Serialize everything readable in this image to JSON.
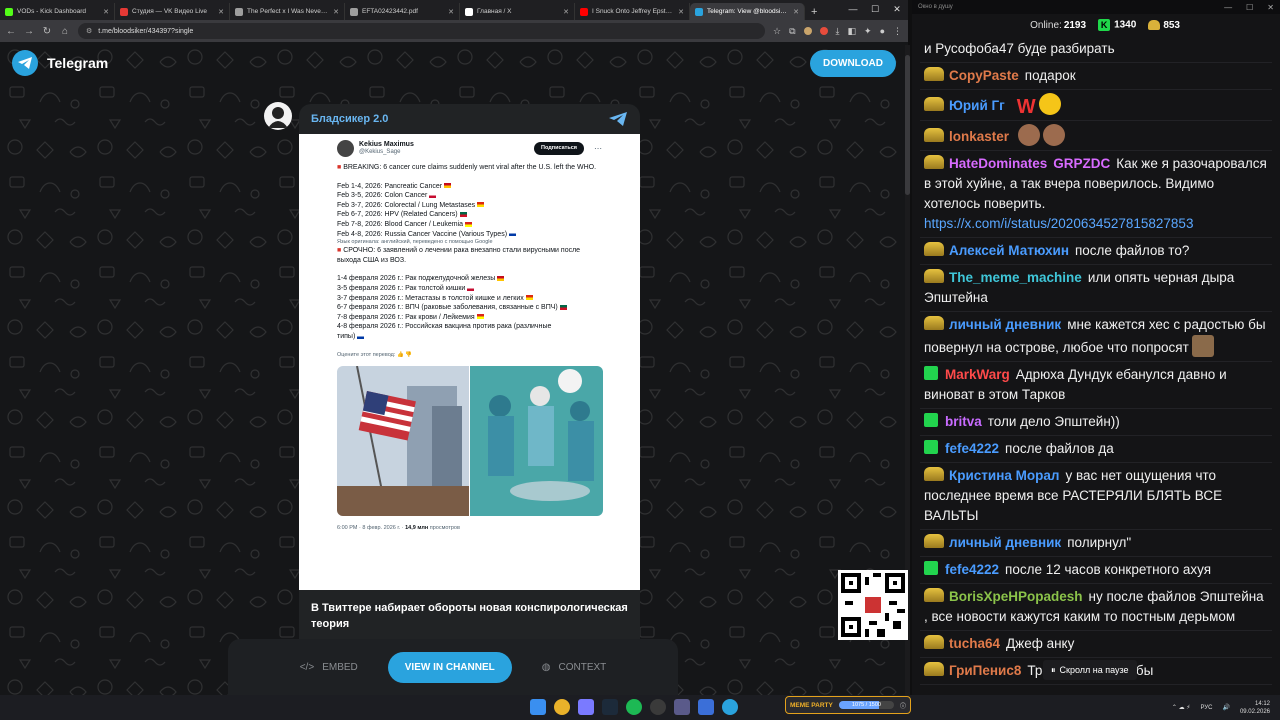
{
  "browser": {
    "tabs": [
      {
        "label": "VODs - Kick Dashboard",
        "color": "#53fc18",
        "active": false
      },
      {
        "label": "Студия — VK Видео Live",
        "color": "#e53935",
        "active": false
      },
      {
        "label": "The Perfect x I Was Never Th",
        "color": "#9e9e9e",
        "active": false
      },
      {
        "label": "EFTA02423442.pdf",
        "color": "#9e9e9e",
        "active": false
      },
      {
        "label": "Главная / X",
        "color": "#ffffff",
        "active": false
      },
      {
        "label": "I Snuck Onto Jeffrey Epstein'",
        "color": "#ff0000",
        "active": false
      },
      {
        "label": "Telegram: View @bloodsiker",
        "color": "#2aa3de",
        "active": true
      }
    ],
    "url": "t.me/bloodsiker/434397?single"
  },
  "telegram": {
    "app_name": "Telegram",
    "download_label": "DOWNLOAD",
    "channel_name": "Бладсикер 2.0",
    "caption": "В Твиттере набирает обороты новая конспирологическая теория",
    "buttons": {
      "embed": "EMBED",
      "view_in_channel": "VIEW IN CHANNEL",
      "context": "CONTEXT"
    },
    "tweet": {
      "name": "Kekius Maximus",
      "handle": "@Kekius_Sage",
      "follow": "Подписаться",
      "breaking": "BREAKING: 6 cancer cure claims suddenly went viral after the U.S. left the WHO.",
      "en_items": [
        {
          "text": "Feb 1-4, 2026: Pancreatic Cancer",
          "flag": "es"
        },
        {
          "text": "Feb 3-5, 2026: Colon Cancer",
          "flag": "kr"
        },
        {
          "text": "Feb 3-7, 2026: Colorectal / Lung Metastases",
          "flag": "cn"
        },
        {
          "text": "Feb 6-7, 2026: HPV (Related Cancers)",
          "flag": "mx"
        },
        {
          "text": "Feb 7-8, 2026: Blood Cancer / Leukemia",
          "flag": "vn"
        },
        {
          "text": "Feb 4-8, 2026: Russia Cancer Vaccine (Various Types)",
          "flag": "ru"
        }
      ],
      "translated_note": "Язык оригинала: английский, переведено с помощью Google",
      "ru_breaking": "СРОЧНО: 6 заявлений о лечении рака внезапно стали вирусными после выхода США из ВОЗ.",
      "ru_items": [
        {
          "text": "1-4 февраля 2026 г.: Рак поджелудочной железы",
          "flag": "es"
        },
        {
          "text": "3-5 февраля 2026 г.: Рак толстой кишки",
          "flag": "kr"
        },
        {
          "text": "3-7 февраля 2026 г.: Метастазы в толстой кишке и легких",
          "flag": "cn"
        },
        {
          "text": "6-7 февраля 2026 г.: ВПЧ (раковые заболевания, связанные с ВПЧ)",
          "flag": "mx"
        },
        {
          "text": "7-8 февраля 2026 г.: Рак крови / Лейкемия",
          "flag": "vn"
        },
        {
          "text": "4-8 февраля 2026 г.: Российская вакцина против рака (различные",
          "flag": ""
        },
        {
          "text": "типы)",
          "flag": "ru"
        }
      ],
      "rate": "Оцените этот перевод:",
      "time": "6:00 PM · 8 февр. 2026 г. ·",
      "views": "14,9 млн",
      "views_label": "просмотров"
    }
  },
  "chat": {
    "window_title": "Окно в душу",
    "online_label": "Online:",
    "online": "2193",
    "kick_count": "1340",
    "coin_count": "853",
    "pause_label": "Скролл на паузе",
    "messages": [
      {
        "user": "",
        "color": "#ffffff",
        "badge": "none",
        "text": "и Русофоба47 буде разбирать"
      },
      {
        "user": "CopyPaste",
        "color": "#e07a4a",
        "badge": "gold",
        "text": "подарок"
      },
      {
        "user": "Юрий Гг",
        "color": "#4a9cff",
        "badge": "gold",
        "text": "",
        "emote": "w"
      },
      {
        "user": "lonkaster",
        "color": "#e07a4a",
        "badge": "gold",
        "text": "",
        "emote": "monkeys"
      },
      {
        "user": "HateDominates",
        "color": "#d86bff",
        "badge": "gold",
        "tag": "GRPZDC",
        "text": "Как же я разочаровался в этой хуйне, а так вчера поверилось. Видимо хотелось поверить.",
        "link": "https://x.com/i/status/2020634527815827853"
      },
      {
        "user": "Алексей Матюхин",
        "color": "#4a9cff",
        "badge": "gold",
        "text": "после файлов то?"
      },
      {
        "user": "The_meme_machine",
        "color": "#3fc6d8",
        "badge": "gold",
        "text": "или опять черная дыра Эпштейна"
      },
      {
        "user": "личный дневник",
        "color": "#4a9cff",
        "badge": "gold",
        "text": "мне кажется хес с радостью бы повернул на острове, любое что попросят",
        "emote": "cat"
      },
      {
        "user": "MarkWarg",
        "color": "#ff4a4a",
        "badge": "kick",
        "text": "Адрюха Дундук ебанулся давно и виноват в этом Тарков"
      },
      {
        "user": "britva",
        "color": "#c86bff",
        "badge": "kick",
        "text": "толи дело Эпштейн))"
      },
      {
        "user": "fefe4222",
        "color": "#4a9cff",
        "badge": "kick",
        "text": "после файлов да"
      },
      {
        "user": "Кристина Морал",
        "color": "#4a9cff",
        "badge": "gold",
        "text": "у вас нет ощущения что последнее время все РАСТЕРЯЛИ БЛЯТЬ ВСЕ ВАЛЬТЫ"
      },
      {
        "user": "личный дневник",
        "color": "#4a9cff",
        "badge": "gold",
        "text": "полирнул\""
      },
      {
        "user": "fefe4222",
        "color": "#4a9cff",
        "badge": "kick",
        "text": "после 12 часов конкретного ахуя"
      },
      {
        "user": "BorisXpeHPopadesh",
        "color": "#8bc34a",
        "badge": "gold",
        "text": "ну после файлов Эпштейна , все новости кажутся каким то постным дерьмом"
      },
      {
        "user": "tucha64",
        "color": "#e07a4a",
        "badge": "gold",
        "text": "Джеф              анку"
      },
      {
        "user": "ГриПенис8",
        "color": "#e07a4a",
        "badge": "gold",
        "text": "Третью мировую бы"
      }
    ]
  },
  "taskbar": {
    "meme_title": "MEME PARTY",
    "meme_progress": "1075 / 1500",
    "meme_fraction": 0.72,
    "lang": "РУС",
    "time": "14:12",
    "date": "09.02.2026"
  }
}
